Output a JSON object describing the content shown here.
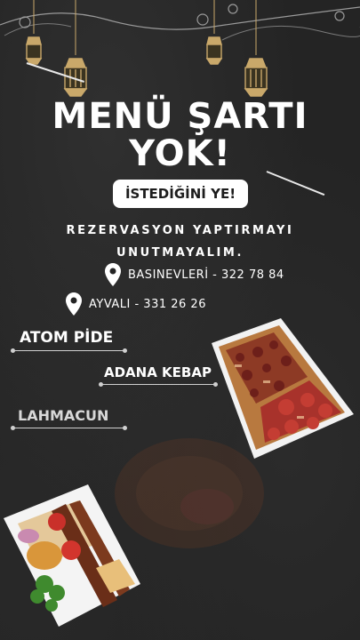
{
  "poster": {
    "title_line1": "MENÜ ŞARTI",
    "title_line2": "YOK!",
    "badge": "İSTEDİĞİNİ YE!",
    "reminder_line1": "REZERVASYON YAPTIRMAYI",
    "reminder_line2": "UNUTMAYALIM.",
    "locations": [
      {
        "label": "BASINEVLERİ - 322 78 84",
        "icon": "map-pin-icon"
      },
      {
        "label": "AYVALI - 331 26 26",
        "icon": "map-pin-icon"
      }
    ],
    "menu": [
      {
        "label": "ATOM PİDE"
      },
      {
        "label": "ADANA KEBAP"
      },
      {
        "label": "LAHMACUN"
      }
    ]
  },
  "colors": {
    "background": "#242424",
    "text": "#ffffff",
    "badge_bg": "#ffffff",
    "badge_text": "#1c1c1c",
    "lantern_gold": "#c9a86a",
    "pide_red": "#a8322b",
    "plate": "#f2f2f2"
  }
}
